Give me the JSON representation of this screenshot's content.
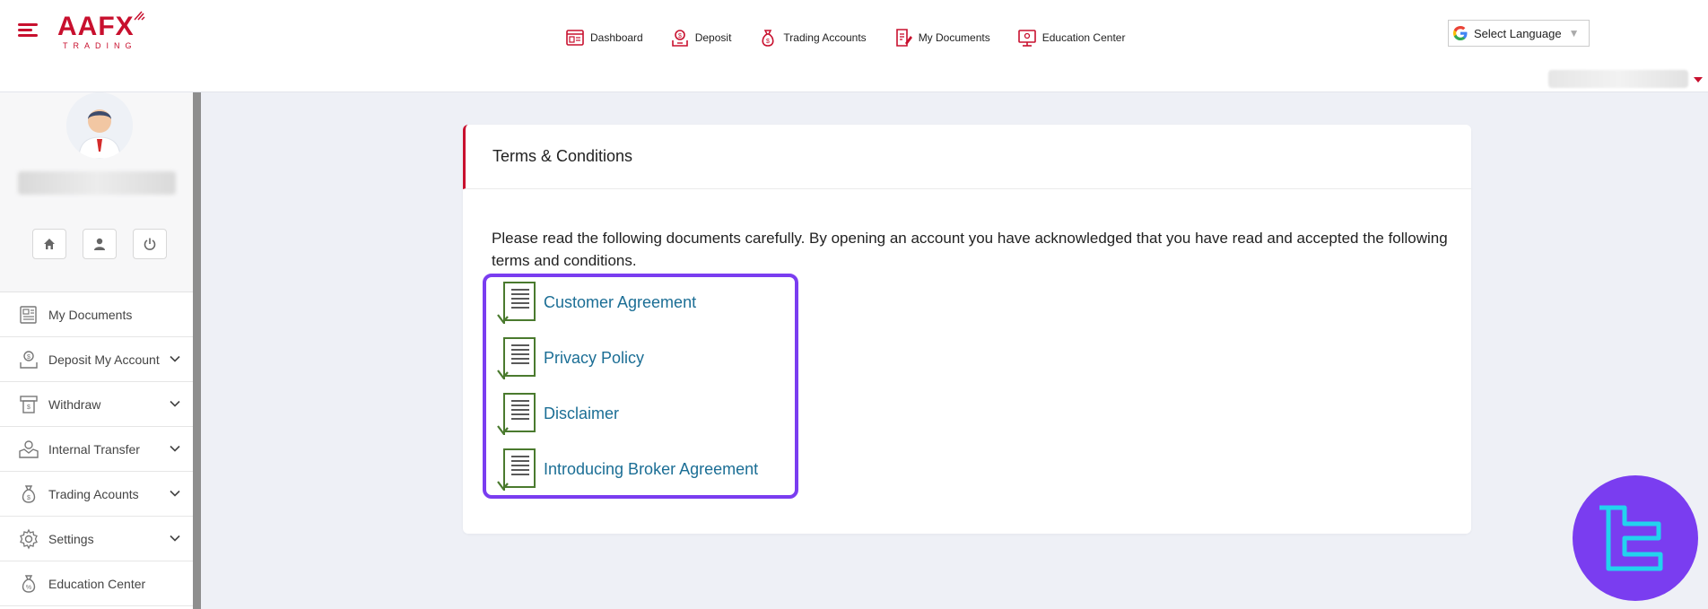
{
  "header": {
    "logo_text": "AAFX",
    "logo_sub": "TRADING",
    "nav": [
      {
        "label": "Dashboard",
        "icon": "dashboard-icon"
      },
      {
        "label": "Deposit",
        "icon": "deposit-icon"
      },
      {
        "label": "Trading Accounts",
        "icon": "money-bag-icon"
      },
      {
        "label": "My Documents",
        "icon": "document-edit-icon"
      },
      {
        "label": "Education Center",
        "icon": "monitor-icon"
      }
    ],
    "language_label": "Select Language",
    "language_caret": "▼"
  },
  "sidebar": {
    "buttons": [
      "home-icon",
      "user-icon",
      "power-icon"
    ],
    "items": [
      {
        "label": "My Documents",
        "icon": "documents-icon",
        "expandable": false
      },
      {
        "label": "Deposit My Account",
        "icon": "deposit-icon",
        "expandable": true
      },
      {
        "label": "Withdraw",
        "icon": "withdraw-icon",
        "expandable": true
      },
      {
        "label": "Internal Transfer",
        "icon": "transfer-icon",
        "expandable": true
      },
      {
        "label": "Trading Acounts",
        "icon": "money-bag-icon",
        "expandable": true
      },
      {
        "label": "Settings",
        "icon": "gear-icon",
        "expandable": true
      },
      {
        "label": "Education Center",
        "icon": "education-icon",
        "expandable": false
      }
    ]
  },
  "main": {
    "title": "Terms & Conditions",
    "intro": "Please read the following documents carefully. By opening an account you have acknowledged that you have read and accepted the following terms and conditions.",
    "documents": [
      {
        "label": "Customer Agreement"
      },
      {
        "label": "Privacy Policy"
      },
      {
        "label": "Disclaimer"
      },
      {
        "label": "Introducing Broker Agreement"
      }
    ]
  },
  "colors": {
    "brand": "#c8102e",
    "link": "#1b6e95",
    "highlight": "#7a3df0",
    "doc_icon": "#4a7a2e"
  }
}
